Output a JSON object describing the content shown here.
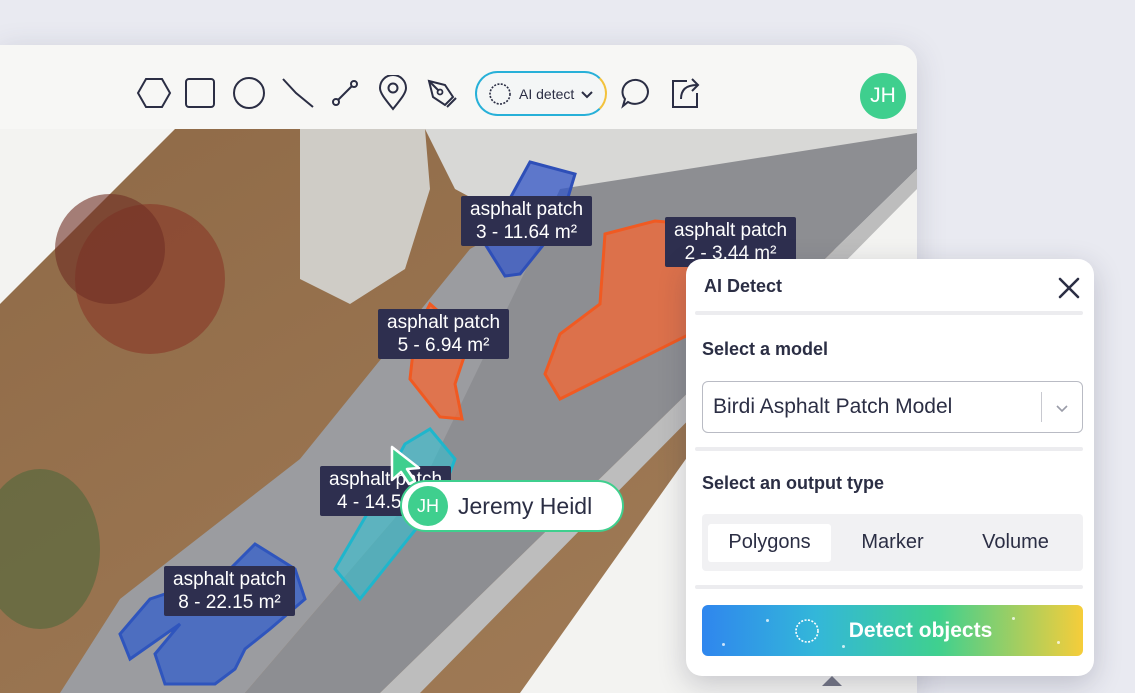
{
  "toolbar": {
    "tools": [
      "hexagon-tool",
      "rectangle-tool",
      "circle-tool",
      "polyline-tool",
      "line-tool",
      "marker-tool",
      "pen-tool"
    ],
    "ai_detect_label": "AI detect",
    "user_initials": "JH"
  },
  "map": {
    "patches": [
      {
        "name": "asphalt patch",
        "value": "3 - 11.64 m²",
        "color": "#3b5bb8"
      },
      {
        "name": "asphalt patch",
        "value": "2 - 3.44 m²",
        "color": "#f2682f"
      },
      {
        "name": "asphalt patch",
        "value": "5 - 6.94 m²",
        "color": "#f2682f"
      },
      {
        "name": "asphalt patch",
        "value": "4 - 14.5",
        "color": "#27b8cc"
      },
      {
        "name": "asphalt patch",
        "value": "8 - 22.15 m²",
        "color": "#3b6ad0"
      }
    ],
    "cursor_user": {
      "initials": "JH",
      "name": "Jeremy Heidl"
    }
  },
  "panel": {
    "title": "AI Detect",
    "model_label": "Select a model",
    "model_value": "Birdi Asphalt Patch Model",
    "output_label": "Select an output type",
    "output_options": [
      "Polygons",
      "Marker",
      "Volume"
    ],
    "output_selected": "Polygons",
    "detect_button": "Detect objects"
  },
  "colors": {
    "accent_green": "#3fcf8e",
    "label_bg": "#2e2f4f",
    "text_dark": "#2b2e44"
  }
}
